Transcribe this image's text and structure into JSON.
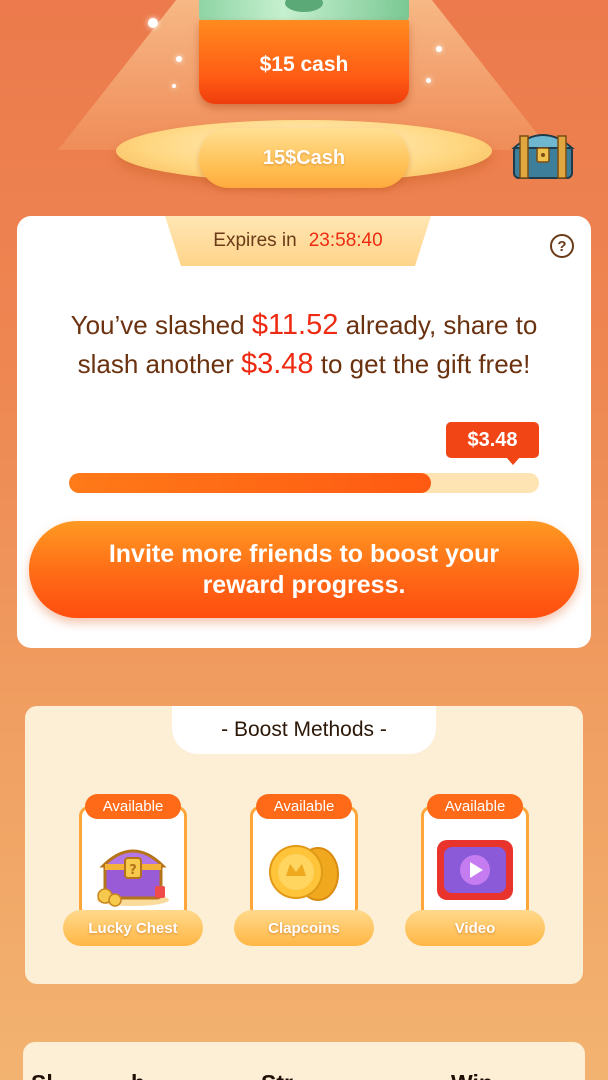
{
  "hero": {
    "prize_card_label": "$15 cash",
    "platform_label": "15$Cash"
  },
  "slash": {
    "expires_label": "Expires in",
    "expires_time": "23:58:40",
    "message_part1": "You’ve slashed ",
    "slashed_amount": "$11.52",
    "message_part2": " already, share to slash another ",
    "remaining_amount": "$3.48",
    "message_part3": " to get the gift free!",
    "remaining_bubble": "$3.48",
    "progress_fraction": 0.77,
    "invite_button_label": "Invite more friends to boost your reward progress."
  },
  "boost": {
    "title": "- Boost Methods -",
    "methods": [
      {
        "badge": "Available",
        "label": "Lucky Chest",
        "icon": "lucky-chest-icon"
      },
      {
        "badge": "Available",
        "label": "Clapcoins",
        "icon": "clapcoins-icon"
      },
      {
        "badge": "Available",
        "label": "Video",
        "icon": "video-icon"
      }
    ]
  },
  "bottom": {
    "headings": [
      "Sl",
      "h",
      "Str",
      "Win"
    ]
  },
  "colors": {
    "accent_red": "#ee2b12",
    "button_orange": "#ff6a16",
    "badge_orange": "#ff6a18",
    "card_cream": "#fdeed6"
  }
}
